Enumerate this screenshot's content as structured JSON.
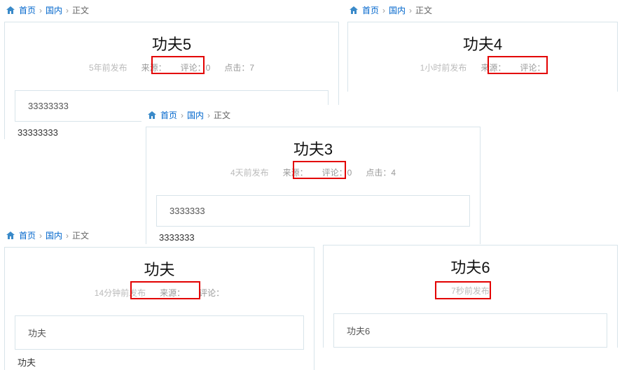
{
  "breadcrumb": {
    "home": "首页",
    "cat": "国内",
    "cur": "正文"
  },
  "labels": {
    "source": "来源：",
    "comments": "评论：",
    "clicks": "点击："
  },
  "panels": {
    "p1": {
      "title": "功夫5",
      "time": "5年前发布",
      "comments": "0",
      "clicks": "7",
      "preview": "33333333",
      "plain": "33333333"
    },
    "p2": {
      "title": "功夫4",
      "time": "1小时前发布"
    },
    "p3": {
      "title": "功夫3",
      "time": "4天前发布",
      "comments": "0",
      "clicks": "4",
      "preview": "3333333",
      "plain": "3333333"
    },
    "p4": {
      "title": "功夫",
      "time": "14分钟前发布",
      "preview": "功夫",
      "plain": "功夫"
    },
    "p5": {
      "title": "功夫6",
      "time": "7秒前发布",
      "preview": "功夫6"
    }
  }
}
